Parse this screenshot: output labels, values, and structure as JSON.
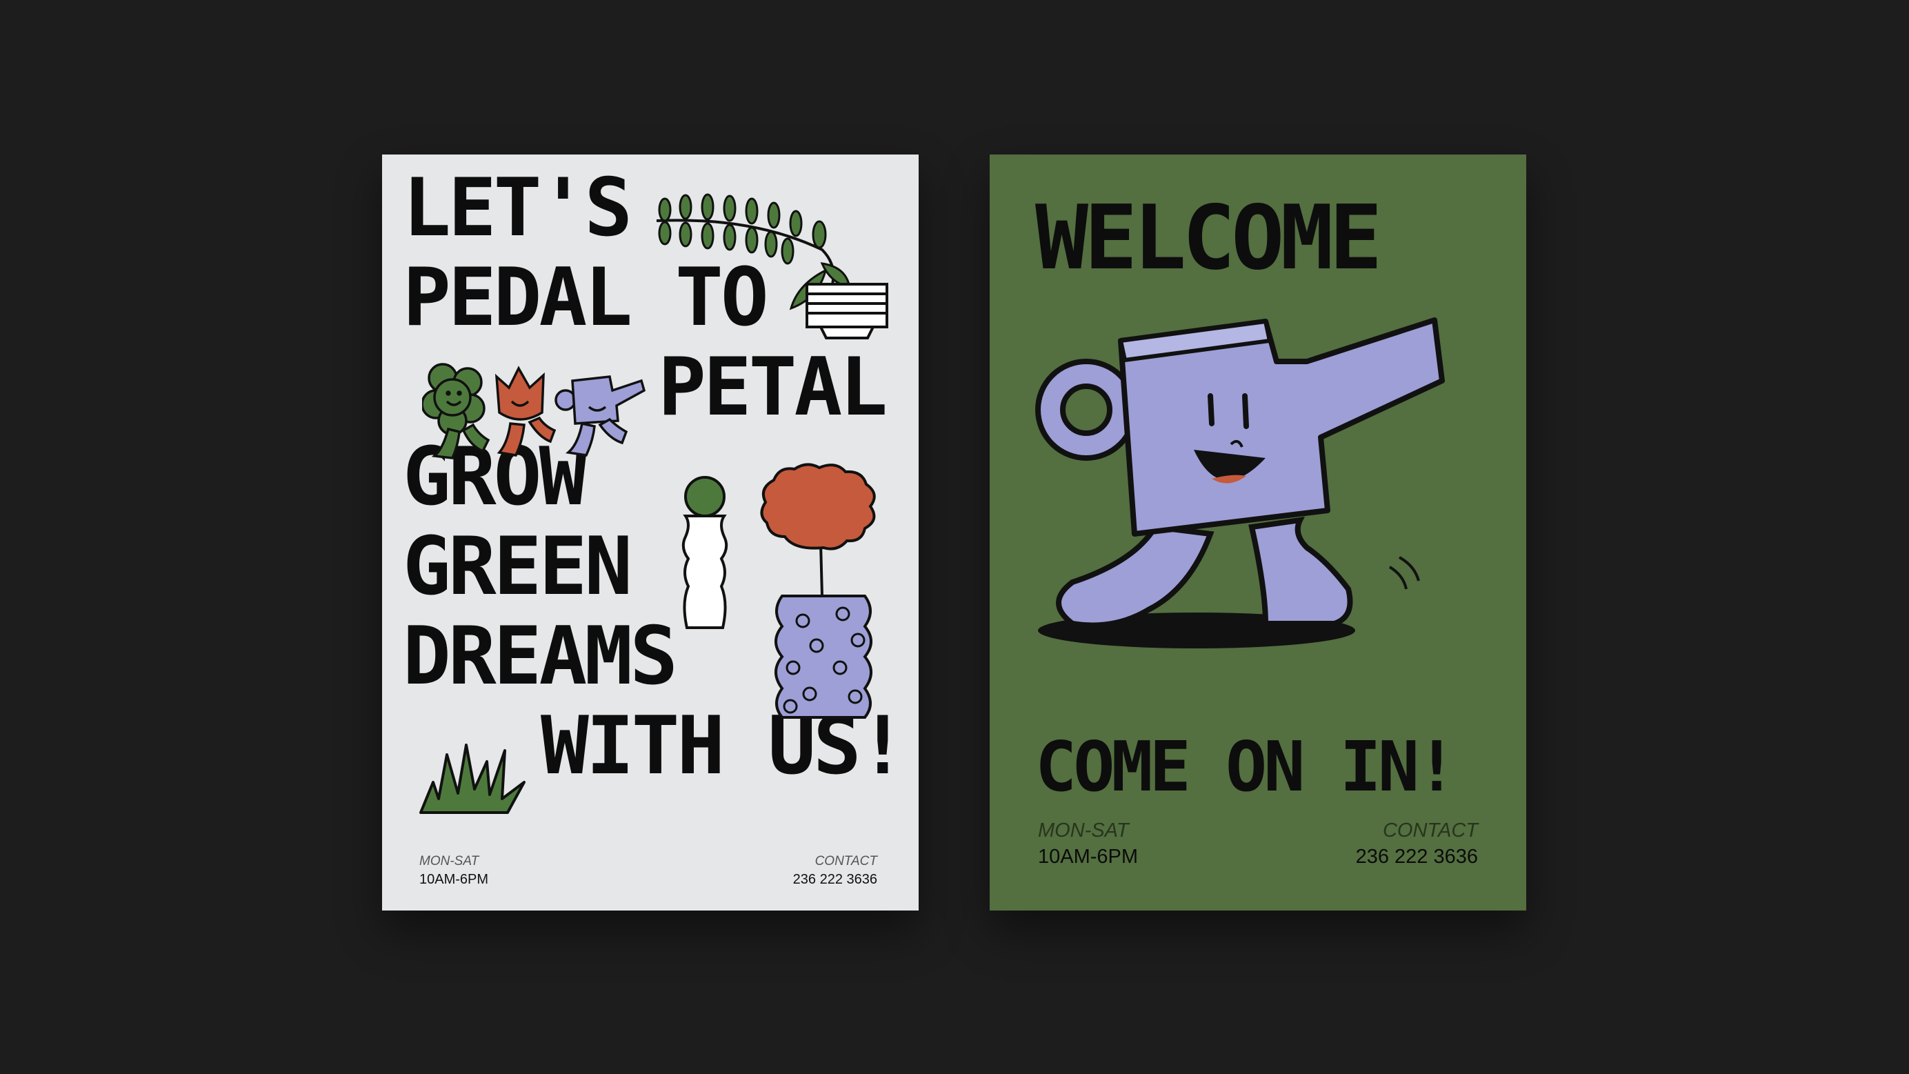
{
  "left_poster": {
    "lines": [
      "LET'S",
      "PEDAL TO",
      "PETAL",
      "GROW",
      "GREEN",
      "DREAMS",
      "WITH US!"
    ],
    "hours_label": "MON-SAT",
    "hours_value": "10AM-6PM",
    "contact_label": "CONTACT",
    "contact_value": "236 222 3636"
  },
  "right_poster": {
    "headline": "WELCOME",
    "tagline": "COME ON IN!",
    "hours_label": "MON-SAT",
    "hours_value": "10AM-6PM",
    "contact_label": "CONTACT",
    "contact_value": "236 222 3636"
  },
  "colors": {
    "background": "#1e1d1e",
    "left_paper": "#e5e7e8",
    "right_paper": "#546f40",
    "leaf_green": "#4d7a3c",
    "terracotta": "#c65a3c",
    "lavender": "#9d9fd6",
    "ink": "#0d0d0d"
  },
  "icons": [
    "fern-sprig-icon",
    "striped-pot-icon",
    "walking-flower-icon",
    "walking-tulip-icon",
    "walking-watering-can-icon",
    "cactus-vase-icon",
    "monstera-leaf-icon",
    "flower-pattern-vase-icon",
    "grass-tuft-icon",
    "watering-can-mascot-icon"
  ]
}
